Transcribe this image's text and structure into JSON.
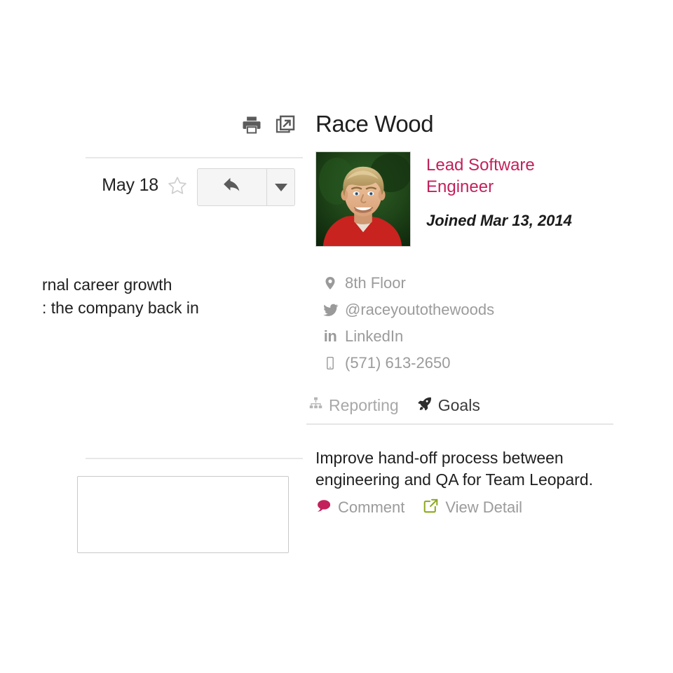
{
  "email": {
    "date": "May 18",
    "star_icon": "star-outline-icon",
    "print_icon": "print-icon",
    "popout_icon": "open-in-new-window-icon",
    "reply_icon": "reply-arrow-icon",
    "more_icon": "chevron-down-icon",
    "body_lines": [
      "rnal career growth",
      ": the company back in"
    ],
    "reply_box_placeholder": ""
  },
  "profile": {
    "name": "Race Wood",
    "title": "Lead Software Engineer",
    "joined": "Joined Mar 13, 2014",
    "avatar_alt": "Race Wood profile photo",
    "contacts": [
      {
        "icon": "location-pin-icon",
        "value": "8th Floor"
      },
      {
        "icon": "twitter-icon",
        "value": "@raceyoutothewoods"
      },
      {
        "icon": "linkedin-icon",
        "value": "LinkedIn"
      },
      {
        "icon": "mobile-phone-icon",
        "value": "(571) 613-2650"
      }
    ],
    "tabs": [
      {
        "icon": "org-chart-icon",
        "label": "Reporting",
        "active": false
      },
      {
        "icon": "rocket-icon",
        "label": "Goals",
        "active": true
      }
    ],
    "goal": {
      "text": "Improve hand-off process between engineering and QA for Team Leopard.",
      "actions": [
        {
          "icon": "comment-bubble-icon",
          "label": "Comment",
          "color": "#c2215c"
        },
        {
          "icon": "external-link-icon",
          "label": "View Detail",
          "color": "#8aa81e"
        }
      ]
    }
  },
  "colors": {
    "title_crimson": "#c2215c",
    "comment_icon": "#c2215c",
    "view_detail_icon": "#8aa81e",
    "muted_text": "#9b9b9b",
    "dark_text": "#1f1f1f",
    "divider": "#e6e6e6",
    "button_face": "#f5f5f5",
    "button_border": "#d7d7d7"
  }
}
